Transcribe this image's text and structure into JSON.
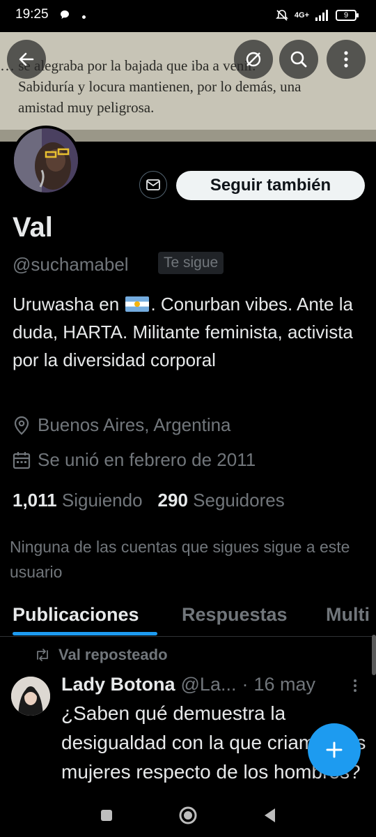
{
  "status_bar": {
    "time": "19:25",
    "network": "4G+",
    "battery": "9"
  },
  "banner": {
    "line1": "… se alegraba por la bajada que iba a venir.",
    "line2": "Sabiduría y locura mantienen, por lo demás, una",
    "line3": "amistad muy peligrosa."
  },
  "profile": {
    "name": "Val",
    "handle": "@suchamabel",
    "follows_you_badge": "Te sigue",
    "follow_button": "Seguir también",
    "bio_part1": "Uruwasha en",
    "bio_part2": ". Conurban vibes. Ante la duda, HARTA. Militante feminista, activista por la diversidad corporal",
    "location": "Buenos Aires, Argentina",
    "joined": "Se unió en febrero de 2011",
    "following_count": "1,011",
    "following_label": "Siguiendo",
    "followers_count": "290",
    "followers_label": "Seguidores",
    "mutual_note": "Ninguna de las cuentas que sigues sigue a este usuario"
  },
  "tabs": [
    {
      "label": "Publicaciones",
      "active": true
    },
    {
      "label": "Respuestas",
      "active": false
    },
    {
      "label": "Multi",
      "active": false
    }
  ],
  "post": {
    "repost_label": "Val reposteado",
    "author_name": "Lady Botona",
    "author_handle": "@La...",
    "separator": "·",
    "time": "16 may",
    "text": "¿Saben qué demuestra la desigualdad con la que criamos las mujeres respecto de los hombres?"
  },
  "colors": {
    "accent": "#1d9bf0",
    "background": "#000000",
    "muted": "#71767b"
  },
  "icons": [
    "back-arrow-icon",
    "hide-icon",
    "search-icon",
    "more-vertical-icon",
    "mail-icon",
    "location-pin-icon",
    "calendar-icon",
    "repost-icon",
    "plus-icon",
    "nav-recents-icon",
    "nav-home-icon",
    "nav-back-icon"
  ]
}
